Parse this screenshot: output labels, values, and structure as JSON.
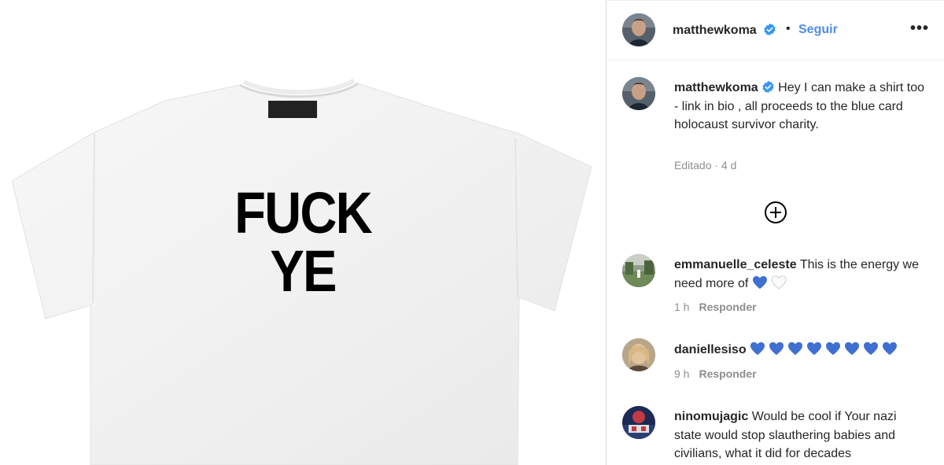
{
  "post": {
    "shirt_text": "FUCK YE"
  },
  "header": {
    "username": "matthewkoma",
    "separator": "•",
    "follow_label": "Seguir",
    "more_label": "•••",
    "verified_icon": "verified-badge-icon"
  },
  "caption": {
    "username": "matthewkoma",
    "text": "Hey I can make a shirt too - link in bio , all proceeds to the blue card holocaust survivor charity.",
    "meta": "Editado · 4 d"
  },
  "load_more_icon": "plus-circle-icon",
  "comments": [
    {
      "username": "emmanuelle_celeste",
      "text": "This is the energy we need more of",
      "hearts": [
        "blue",
        "white"
      ],
      "time": "1 h",
      "reply_label": "Responder"
    },
    {
      "username": "daniellesiso",
      "text": "",
      "hearts": [
        "blue",
        "blue",
        "blue",
        "blue",
        "blue",
        "blue",
        "blue",
        "blue"
      ],
      "time": "9 h",
      "reply_label": "Responder"
    },
    {
      "username": "ninomujagic",
      "text": "Would be cool if Your nazi state would stop slauthering babies and civilians, what it did for decades",
      "hearts": [],
      "time": "",
      "reply_label": ""
    }
  ],
  "colors": {
    "link_blue": "#4f8ce6",
    "heart_blue": "#3f6fd1",
    "verified_blue": "#3897f0",
    "muted_text": "#8e8e8e"
  }
}
